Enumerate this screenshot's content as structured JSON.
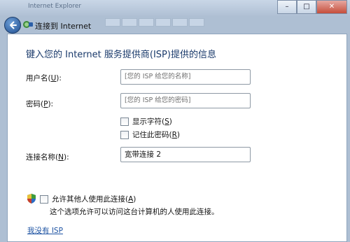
{
  "window": {
    "title_ghost": "Internet Explorer",
    "tabs_ghost": [
      "",
      "",
      "",
      "",
      "",
      ""
    ],
    "controls": {
      "minimize": "–",
      "maximize": "□",
      "close": "✕"
    }
  },
  "nav": {
    "title": "连接到 Internet"
  },
  "heading": "键入您的 Internet 服务提供商(ISP)提供的信息",
  "form": {
    "username": {
      "label_pre": "用户名(",
      "label_key": "U",
      "label_post": "):",
      "placeholder": "[您的 ISP 给您的名称]"
    },
    "password": {
      "label_pre": "密码(",
      "label_key": "P",
      "label_post": "):",
      "placeholder": "[您的 ISP 给您的密码]"
    },
    "show_chars": {
      "pre": "显示字符(",
      "key": "S",
      "post": ")",
      "checked": false
    },
    "remember": {
      "pre": "记住此密码(",
      "key": "R",
      "post": ")",
      "checked": false
    },
    "conn_name": {
      "label_pre": "连接名称(",
      "label_key": "N",
      "label_post": "):",
      "value": "宽带连接 2"
    }
  },
  "allow": {
    "pre": "允许其他人使用此连接(",
    "key": "A",
    "post": ")",
    "checked": false,
    "description": "这个选项允许可以访问这台计算机的人使用此连接。"
  },
  "link": "我没有 ISP",
  "icons": {
    "back": "back-arrow-icon",
    "network": "network-connection-icon",
    "shield": "uac-shield-icon"
  }
}
